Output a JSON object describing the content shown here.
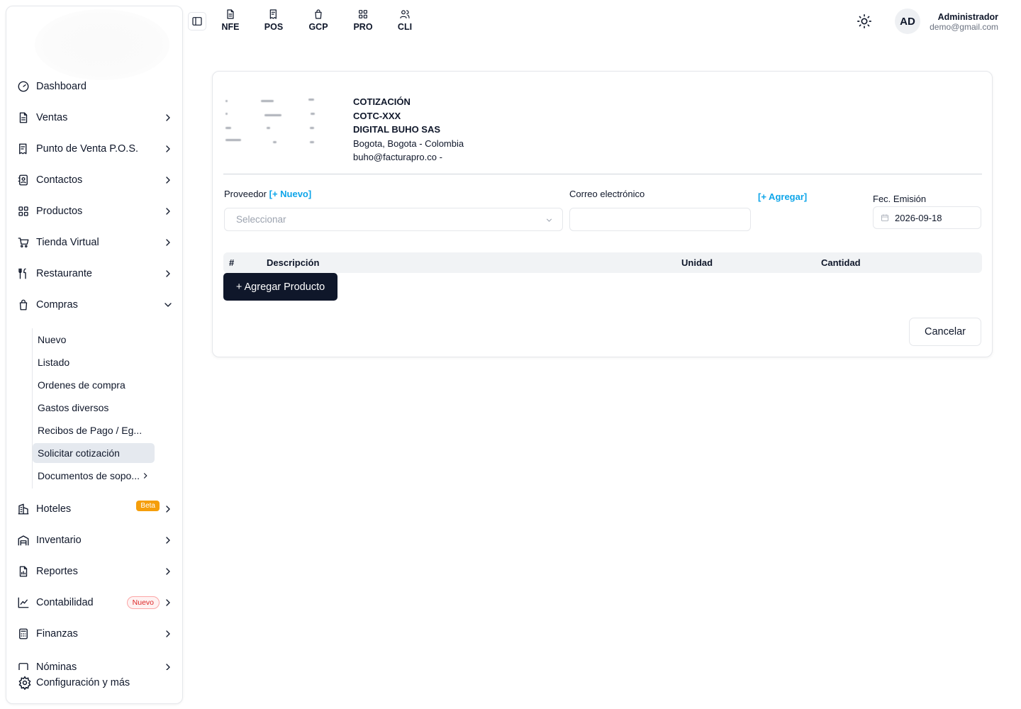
{
  "sidebar": {
    "items": [
      {
        "label": "Dashboard",
        "icon": "gauge-icon"
      },
      {
        "label": "Ventas",
        "icon": "document-icon"
      },
      {
        "label": "Punto de Venta P.O.S.",
        "icon": "pos-receipt-icon"
      },
      {
        "label": "Contactos",
        "icon": "contacts-icon"
      },
      {
        "label": "Productos",
        "icon": "grid-icon"
      },
      {
        "label": "Tienda Virtual",
        "icon": "cart-icon"
      },
      {
        "label": "Restaurante",
        "icon": "utensils-icon"
      },
      {
        "label": "Compras",
        "icon": "shopping-bag-icon"
      }
    ],
    "compras_sub": [
      "Nuevo",
      "Listado",
      "Ordenes de compra",
      "Gastos diversos",
      "Recibos de Pago / Eg...",
      "Solicitar cotización",
      "Documentos de sopo..."
    ],
    "items_after": [
      {
        "label": "Hoteles",
        "icon": "building-icon",
        "badge": "Beta"
      },
      {
        "label": "Inventario",
        "icon": "warehouse-icon"
      },
      {
        "label": "Reportes",
        "icon": "report-icon"
      },
      {
        "label": "Contabilidad",
        "icon": "chart-icon",
        "badge": "Nuevo"
      },
      {
        "label": "Finanzas",
        "icon": "calculator-icon"
      },
      {
        "label": "Nóminas",
        "icon": "payroll-icon"
      }
    ],
    "config_label": "Configuración y más"
  },
  "topbar": {
    "tabs": [
      "NFE",
      "POS",
      "GCP",
      "PRO",
      "CLI"
    ],
    "user": {
      "initials": "AD",
      "name": "Administrador",
      "email": "demo@gmail.com"
    }
  },
  "quote": {
    "title": "COTIZACIÓN",
    "number": "COTC-XXX",
    "company": "DIGITAL BUHO SAS",
    "location": "Bogota, Bogota - Colombia",
    "contact": "buho@facturapro.co -",
    "proveedor_label": "Proveedor",
    "proveedor_new_link": "[+ Nuevo]",
    "proveedor_placeholder": "Seleccionar",
    "email_label": "Correo electrónico",
    "email_value": "",
    "agregar_link": "[+ Agregar]",
    "date_label": "Fec. Emisión",
    "date_value": "2026-09-18",
    "table_headers": [
      "#",
      "Descripción",
      "Unidad",
      "Cantidad"
    ],
    "add_product_button": "+ Agregar Producto",
    "cancel_button": "Cancelar"
  },
  "colors": {
    "accent_link": "#0ea5e9",
    "primary_button": "#0f172a",
    "beta_badge": "#f59e0b",
    "nuevo_badge": "#dc2626"
  }
}
